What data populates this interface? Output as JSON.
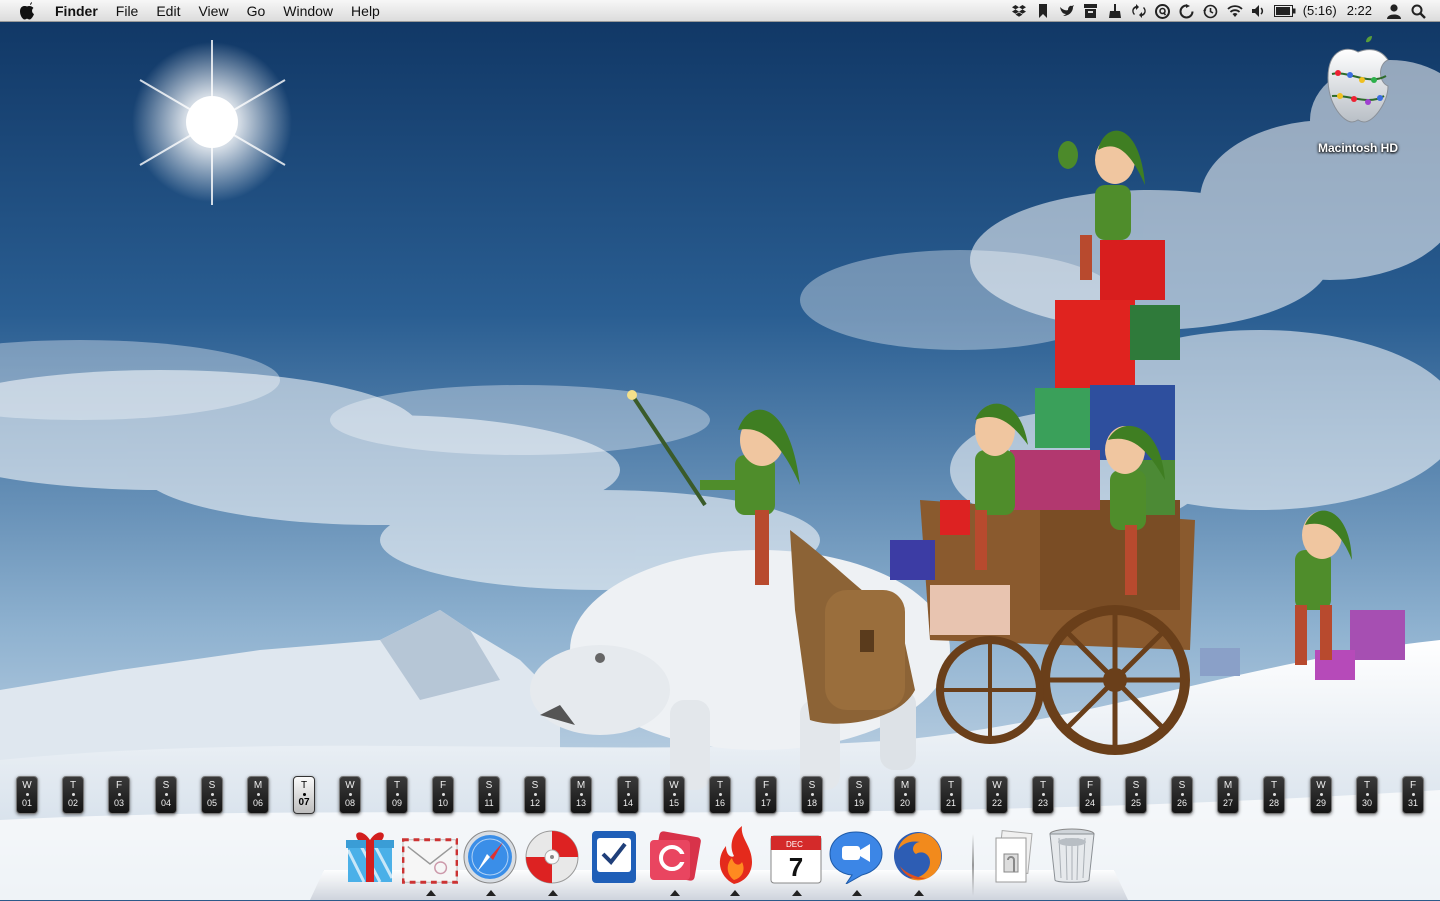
{
  "menubar": {
    "app_name": "Finder",
    "menus": [
      "File",
      "Edit",
      "View",
      "Go",
      "Window",
      "Help"
    ],
    "status_icons": [
      "dropbox-icon",
      "bookmark-icon",
      "bird-icon",
      "archive-icon",
      "broom-icon",
      "sync-arrows-icon",
      "q-circle-icon",
      "refresh-icon",
      "time-machine-icon",
      "wifi-icon",
      "volume-icon",
      "battery-icon"
    ],
    "battery_text": "(5:16)",
    "clock": "2:22",
    "user_icon": "user-icon",
    "spotlight_icon": "spotlight-search-icon"
  },
  "desktop": {
    "hd_label": "Macintosh HD"
  },
  "calendar": {
    "today_index": 6,
    "days": [
      {
        "dow": "W",
        "num": "01"
      },
      {
        "dow": "T",
        "num": "02"
      },
      {
        "dow": "F",
        "num": "03"
      },
      {
        "dow": "S",
        "num": "04"
      },
      {
        "dow": "S",
        "num": "05"
      },
      {
        "dow": "M",
        "num": "06"
      },
      {
        "dow": "T",
        "num": "07"
      },
      {
        "dow": "W",
        "num": "08"
      },
      {
        "dow": "T",
        "num": "09"
      },
      {
        "dow": "F",
        "num": "10"
      },
      {
        "dow": "S",
        "num": "11"
      },
      {
        "dow": "S",
        "num": "12"
      },
      {
        "dow": "M",
        "num": "13"
      },
      {
        "dow": "T",
        "num": "14"
      },
      {
        "dow": "W",
        "num": "15"
      },
      {
        "dow": "T",
        "num": "16"
      },
      {
        "dow": "F",
        "num": "17"
      },
      {
        "dow": "S",
        "num": "18"
      },
      {
        "dow": "S",
        "num": "19"
      },
      {
        "dow": "M",
        "num": "20"
      },
      {
        "dow": "T",
        "num": "21"
      },
      {
        "dow": "W",
        "num": "22"
      },
      {
        "dow": "T",
        "num": "23"
      },
      {
        "dow": "F",
        "num": "24"
      },
      {
        "dow": "S",
        "num": "25"
      },
      {
        "dow": "S",
        "num": "26"
      },
      {
        "dow": "M",
        "num": "27"
      },
      {
        "dow": "T",
        "num": "28"
      },
      {
        "dow": "W",
        "num": "29"
      },
      {
        "dow": "T",
        "num": "30"
      },
      {
        "dow": "F",
        "num": "31"
      }
    ]
  },
  "dock": {
    "items": [
      {
        "name": "gift-app-icon",
        "running": false
      },
      {
        "name": "mail-stamp-icon",
        "running": true
      },
      {
        "name": "safari-icon",
        "running": true
      },
      {
        "name": "itunes-disc-icon",
        "running": true
      },
      {
        "name": "todo-checkbox-icon",
        "running": false
      },
      {
        "name": "stickies-c-icon",
        "running": true
      },
      {
        "name": "flame-app-icon",
        "running": true
      },
      {
        "name": "ical-icon",
        "running": true
      },
      {
        "name": "ichat-video-icon",
        "running": true
      },
      {
        "name": "firefox-icon",
        "running": true
      },
      {
        "name": "documents-stack-icon",
        "running": false
      },
      {
        "name": "trash-icon",
        "running": false
      }
    ],
    "ical_month": "DEC",
    "ical_day": "7"
  },
  "colors": {
    "menubar_bg": "#e8e8e8",
    "sky_top": "#123a6b",
    "snow": "#eef2f7"
  }
}
